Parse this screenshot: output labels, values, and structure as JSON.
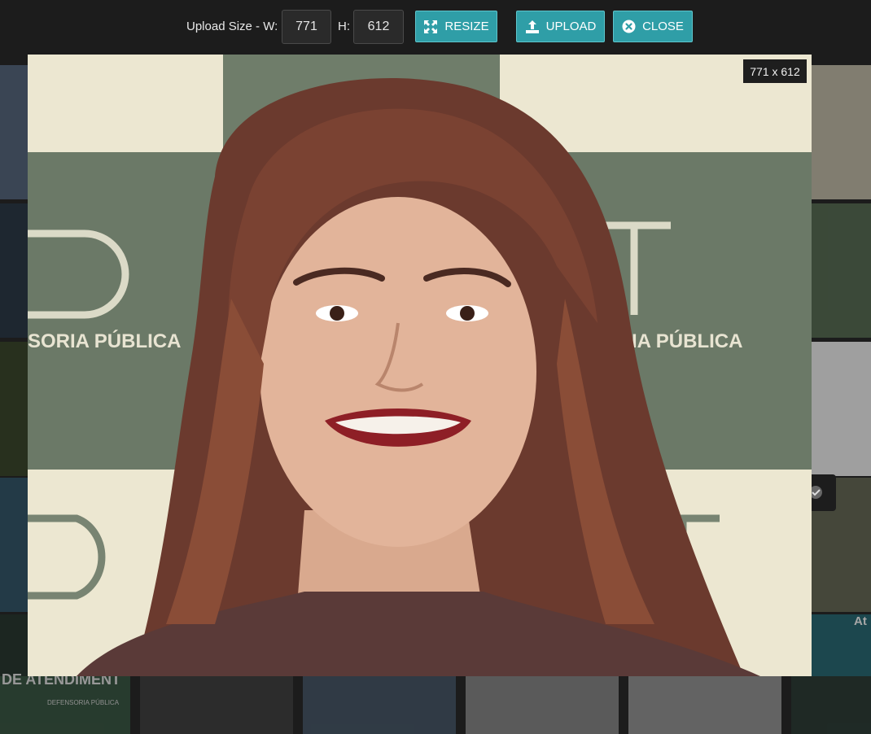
{
  "toolbar": {
    "upload_size_label": "Upload Size - W:",
    "width_value": "771",
    "height_label": "H:",
    "height_value": "612",
    "resize_label": "RESIZE",
    "upload_label": "UPLOAD",
    "close_label": "CLOSE",
    "icons": {
      "resize": "expand-arrows-icon",
      "upload": "upload-icon",
      "close": "close-circle-icon"
    },
    "accent_color": "#2f9ea7"
  },
  "preview": {
    "size_badge": "771 x 612",
    "backdrop_logo_text": "DPT",
    "backdrop_subtitle": "SORIA PÚBLICA"
  },
  "background_thumbs": {
    "bottom_left_title": "DE ATENDIMENT",
    "bottom_left_logo": "DEFENSORIA PÚBLICA",
    "right_side_text": "At"
  }
}
